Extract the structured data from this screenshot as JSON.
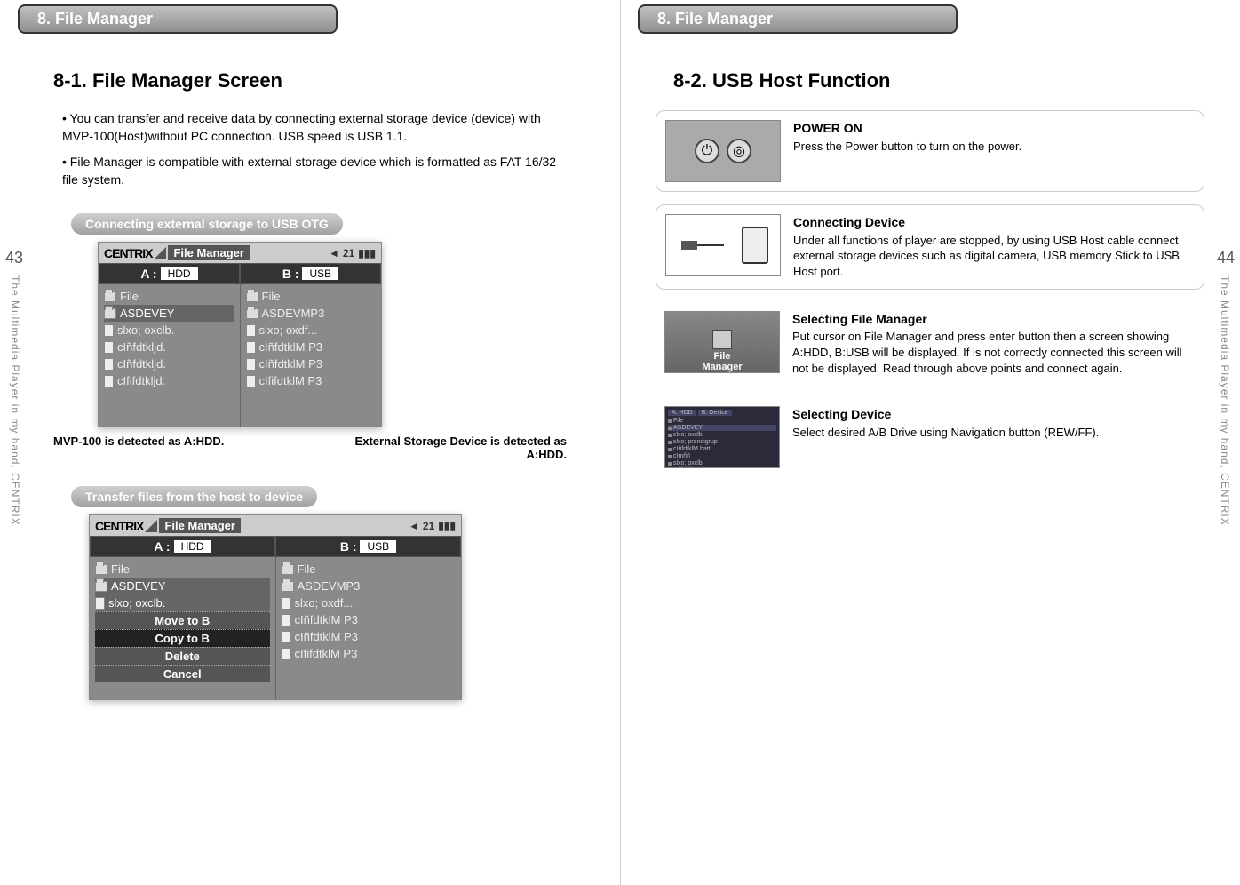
{
  "chapter": "8. File Manager",
  "side_text": "The Multimedia Player in my hand, CENTRIX",
  "page_left_num": "43",
  "page_right_num": "44",
  "left": {
    "section_title": "8-1. File Manager Screen",
    "p1": "• You can transfer and receive data by connecting external storage device (device) with MVP-100(Host)without PC connection.  USB speed is USB 1.1.",
    "p2": "• File Manager is compatible with external storage device which is formatted as FAT 16/32 file system.",
    "pill1": "Connecting external storage  to USB OTG",
    "pill2": "Transfer files from the host to device",
    "caption_left": "MVP-100 is detected as A:HDD.",
    "caption_right": "External Storage Device is detected as A:HDD.",
    "screenshot1": {
      "brand": "CENTRIX",
      "app": "File Manager",
      "vol": "21",
      "driveA": "A :",
      "driveA_tag": "HDD",
      "driveB": "B :",
      "driveB_tag": "USB",
      "colA_head": "File",
      "colB_head": "File",
      "colA": [
        "ASDEVEY",
        "slxo; oxclb.",
        "cIñfdtkljd.",
        "cIñfdtkljd.",
        "cIfifdtkljd."
      ],
      "colB": [
        "ASDEVMP3",
        "slxo; oxdf...",
        "cIñfdtklM P3",
        "cIñfdtklM P3",
        "cIfifdtklM P3"
      ]
    },
    "screenshot2": {
      "brand": "CENTRIX",
      "app": "File Manager",
      "vol": "21",
      "driveA": "A :",
      "driveA_tag": "HDD",
      "driveB": "B :",
      "driveB_tag": "USB",
      "colA_head": "File",
      "colB_head": "File",
      "colA": [
        "ASDEVEY",
        "slxo; oxclb."
      ],
      "menu": [
        "Move to B",
        "Copy to B",
        "Delete",
        "Cancel"
      ],
      "colB": [
        "ASDEVMP3",
        "slxo; oxdf...",
        "cIñfdtklM P3",
        "cIñfdtklM P3",
        "cIfifdtklM P3"
      ]
    }
  },
  "right": {
    "section_title": "8-2. USB Host Function",
    "steps": [
      {
        "title": "POWER ON",
        "body": "Press the Power button to turn on the power.",
        "thumb": "power"
      },
      {
        "title": "Connecting Device",
        "body": "Under all functions of player are stopped, by using USB Host cable connect external storage devices such as digital camera, USB memory Stick to USB Host port.",
        "thumb": "conn"
      },
      {
        "title": "Selecting File Manager",
        "body": "Put cursor on File Manager and press enter button then a screen showing A:HDD, B:USB will be displayed. If is not correctly connected this screen will not be displayed. Read through above points and connect again.",
        "thumb": "filemgr",
        "thumb_label": "File",
        "thumb_label2": "Manager"
      },
      {
        "title": "Selecting Device",
        "body": "Select desired A/B Drive using Navigation button (REW/FF).",
        "thumb": "minifm"
      }
    ]
  }
}
